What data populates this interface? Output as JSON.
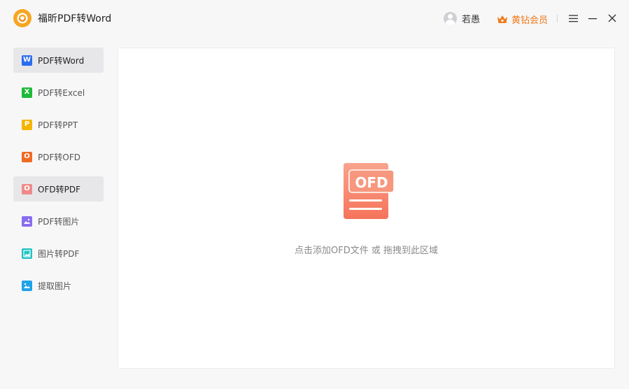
{
  "app": {
    "title": "福昕PDF转Word",
    "logo_icon": "foxit-logo-icon",
    "accent": "#f6a623"
  },
  "header": {
    "user_name": "若愚",
    "vip_label": "黄钻会员",
    "vip_color": "#f07a1a"
  },
  "sidebar": {
    "items": [
      {
        "label": "PDF转Word",
        "icon_letter": "W",
        "icon_color": "#2b6cf0",
        "active": true
      },
      {
        "label": "PDF转Excel",
        "icon_letter": "X",
        "icon_color": "#1fba3a",
        "active": false
      },
      {
        "label": "PDF转PPT",
        "icon_letter": "P",
        "icon_color": "#f5b400",
        "active": false
      },
      {
        "label": "PDF转OFD",
        "icon_letter": "O",
        "icon_color": "#f06a22",
        "active": false
      },
      {
        "label": "OFD转PDF",
        "icon_letter": "O",
        "icon_color": "#f08a8a",
        "active": true
      },
      {
        "label": "PDF转图片",
        "icon_letter": "",
        "icon_color": "#8a6cf0",
        "active": false
      },
      {
        "label": "图片转PDF",
        "icon_letter": "",
        "icon_color": "#1ec2c2",
        "active": false
      },
      {
        "label": "提取图片",
        "icon_letter": "",
        "icon_color": "#1ea2e8",
        "active": false
      }
    ]
  },
  "main": {
    "file_badge": "OFD",
    "file_color": "#f8866a",
    "hint": "点击添加OFD文件 或 拖拽到此区域"
  }
}
